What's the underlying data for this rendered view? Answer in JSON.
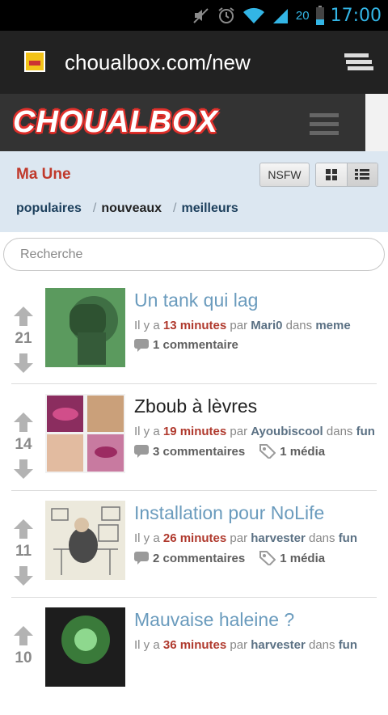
{
  "status_bar": {
    "battery": "20",
    "time": "17:00"
  },
  "browser": {
    "url": "choualbox.com/new"
  },
  "site": {
    "logo": "CHOUALBOX"
  },
  "section": {
    "title": "Ma Une",
    "nsfw_label": "NSFW",
    "tabs": [
      {
        "label": "populaires"
      },
      {
        "label": "nouveaux",
        "active": true
      },
      {
        "label": "meilleurs"
      }
    ]
  },
  "search": {
    "placeholder": "Recherche"
  },
  "posts": [
    {
      "score": "21",
      "title": "Un tank qui lag",
      "ago_prefix": "Il y a",
      "time": "13 minutes",
      "by": "par",
      "user": "Mari0",
      "in": "dans",
      "category": "meme",
      "comments": "1 commentaire",
      "media": ""
    },
    {
      "score": "14",
      "title": "Zboub à lèvres",
      "ago_prefix": "Il y a",
      "time": "19 minutes",
      "by": "par",
      "user": "Ayoubiscool",
      "in": "dans",
      "category": "fun",
      "comments": "3 commentaires",
      "media": "1 média"
    },
    {
      "score": "11",
      "title": "Installation pour NoLife",
      "ago_prefix": "Il y a",
      "time": "26 minutes",
      "by": "par",
      "user": "harvester",
      "in": "dans",
      "category": "fun",
      "comments": "2 commentaires",
      "media": "1 média"
    },
    {
      "score": "10",
      "title": "Mauvaise haleine ?",
      "ago_prefix": "Il y a",
      "time": "36 minutes",
      "by": "par",
      "user": "harvester",
      "in": "dans",
      "category": "fun",
      "comments": "",
      "media": ""
    }
  ],
  "colors": {
    "accent_blue": "#33b5e5",
    "logo_red": "#e0312c",
    "time_red": "#b03a2e",
    "title_blue": "#6a9bbd"
  }
}
